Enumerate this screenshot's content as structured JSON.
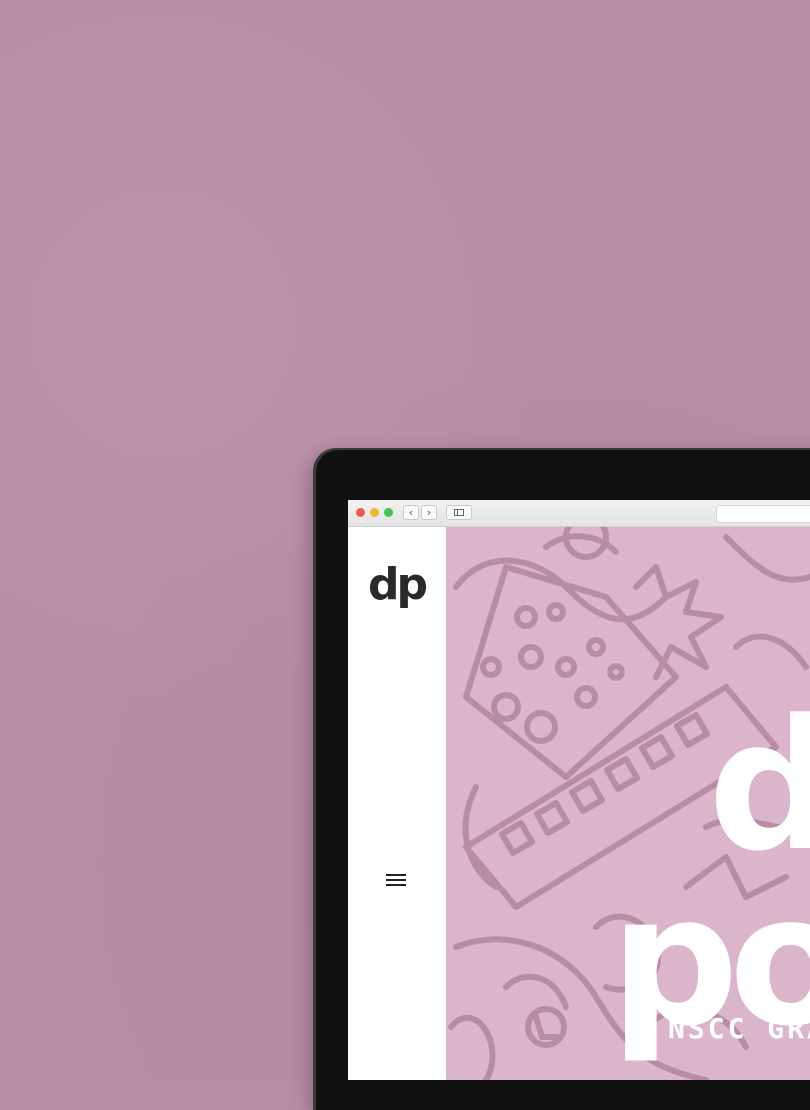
{
  "colors": {
    "wall": "#b88ca5",
    "hero_bg": "#dbb6cb",
    "hero_lines": "#b98ca5",
    "hero_text": "#ffffff",
    "logo": "#2a2a2a"
  },
  "browser": {
    "back_icon": "‹",
    "forward_icon": "›"
  },
  "sidebar": {
    "logo_text": "dp",
    "menu_icon": "hamburger-icon"
  },
  "hero": {
    "line1": "d",
    "line2": "po",
    "tagline": "NSCC GRA"
  }
}
